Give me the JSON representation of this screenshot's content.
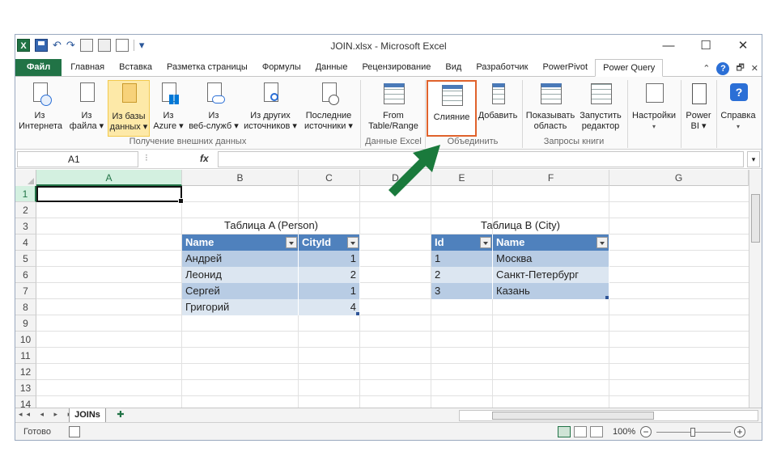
{
  "app": {
    "title": "JOIN.xlsx - Microsoft Excel",
    "logo": "X",
    "window_controls": {
      "minimize": "—",
      "maximize": "☐",
      "close": "✕"
    }
  },
  "qat": {
    "undo": "↶",
    "redo": "↷",
    "dropdown": "▾"
  },
  "tabs": [
    {
      "label": "Файл",
      "kind": "file"
    },
    {
      "label": "Главная"
    },
    {
      "label": "Вставка"
    },
    {
      "label": "Разметка страницы"
    },
    {
      "label": "Формулы"
    },
    {
      "label": "Данные"
    },
    {
      "label": "Рецензирование"
    },
    {
      "label": "Вид"
    },
    {
      "label": "Разработчик"
    },
    {
      "label": "PowerPivot"
    },
    {
      "label": "Power Query",
      "kind": "active"
    }
  ],
  "tabs_right": {
    "collapse": "⌃",
    "help": "?",
    "restore": "🗗",
    "close": "✕"
  },
  "ribbon": {
    "buttons": {
      "web": {
        "line1": "Из",
        "line2": "Интернета"
      },
      "file": {
        "line1": "Из",
        "line2": "файла ▾"
      },
      "db": {
        "line1": "Из базы",
        "line2": "данных ▾"
      },
      "azure": {
        "line1": "Из",
        "line2": "Azure ▾"
      },
      "webservices": {
        "line1": "Из",
        "line2": "веб-служб ▾"
      },
      "other": {
        "line1": "Из других",
        "line2": "источников ▾"
      },
      "recent": {
        "line1": "Последние",
        "line2": "источники ▾"
      },
      "fromtable": {
        "line1": "From",
        "line2": "Table/Range"
      },
      "merge": {
        "line1": "Слияние"
      },
      "append": {
        "line1": "Добавить"
      },
      "showpane": {
        "line1": "Показывать",
        "line2": "область"
      },
      "editor": {
        "line1": "Запустить",
        "line2": "редактор"
      },
      "settings": {
        "line1": "Настройки",
        "line2": "▾"
      },
      "powerbi": {
        "line1": "Power",
        "line2": "BI ▾"
      },
      "help": {
        "line1": "Справка",
        "line2": "▾"
      }
    },
    "groups": {
      "external": "Получение внешних данных",
      "excel": "Данные Excel",
      "combine": "Объединить",
      "workbook": "Запросы книги"
    }
  },
  "formula_bar": {
    "name_box": "A1",
    "fx": "fx",
    "value": ""
  },
  "columns": [
    "A",
    "B",
    "C",
    "D",
    "E",
    "F",
    "G"
  ],
  "rows": [
    "1",
    "2",
    "3",
    "4",
    "5",
    "6",
    "7",
    "8",
    "9",
    "10",
    "11",
    "12",
    "13",
    "14"
  ],
  "table_a": {
    "caption": "Таблица A (Person)",
    "headers": [
      "Name",
      "CityId"
    ],
    "rows": [
      [
        "Андрей",
        "1"
      ],
      [
        "Леонид",
        "2"
      ],
      [
        "Сергей",
        "1"
      ],
      [
        "Григорий",
        "4"
      ]
    ]
  },
  "table_b": {
    "caption": "Таблица B (City)",
    "headers": [
      "Id",
      "Name"
    ],
    "rows": [
      [
        "1",
        "Москва"
      ],
      [
        "2",
        "Санкт-Петербург"
      ],
      [
        "3",
        "Казань"
      ]
    ]
  },
  "sheets": {
    "active": "JOINs",
    "nav": "◂◂ ◂ ▸ ▸▸"
  },
  "status": {
    "ready": "Готово",
    "zoom": "100%",
    "zoom_minus": "−",
    "zoom_plus": "+"
  },
  "colors": {
    "accent": "#217346",
    "table_header": "#4f81bd",
    "highlight_border": "#e0622c",
    "arrow": "#1a7a3c"
  }
}
